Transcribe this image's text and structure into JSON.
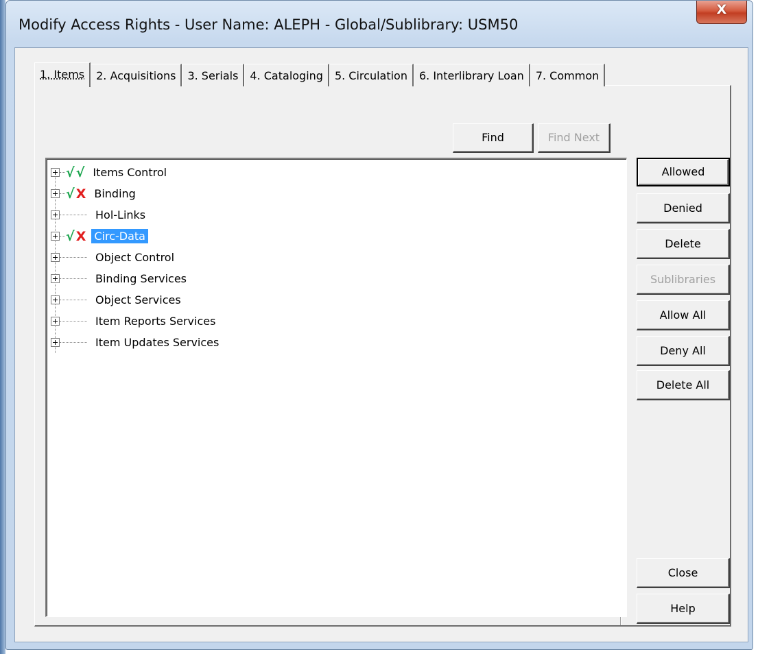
{
  "window": {
    "title": "Modify Access Rights - User Name: ALEPH - Global/Sublibrary: USM50",
    "close_glyph": "X"
  },
  "tabs": [
    {
      "label": "1. Items",
      "active": true
    },
    {
      "label": "2. Acquisitions",
      "active": false
    },
    {
      "label": "3. Serials",
      "active": false
    },
    {
      "label": "4. Cataloging",
      "active": false
    },
    {
      "label": "5. Circulation",
      "active": false
    },
    {
      "label": "6. Interlibrary Loan",
      "active": false
    },
    {
      "label": "7. Common",
      "active": false
    }
  ],
  "search": {
    "find_label": "Find",
    "find_next_label": "Find Next"
  },
  "tree": {
    "nodes": [
      {
        "label": "Items Control",
        "icons": [
          "check",
          "check"
        ],
        "selected": false
      },
      {
        "label": "Binding",
        "icons": [
          "check",
          "cross"
        ],
        "selected": false
      },
      {
        "label": "Hol-Links",
        "icons": [],
        "selected": false
      },
      {
        "label": "Circ-Data",
        "icons": [
          "check",
          "cross"
        ],
        "selected": true
      },
      {
        "label": "Object Control",
        "icons": [],
        "selected": false
      },
      {
        "label": "Binding Services",
        "icons": [],
        "selected": false
      },
      {
        "label": "Object Services",
        "icons": [],
        "selected": false
      },
      {
        "label": "Item Reports Services",
        "icons": [],
        "selected": false
      },
      {
        "label": "Item Updates Services",
        "icons": [],
        "selected": false
      }
    ],
    "glyphs": {
      "check": "√",
      "cross": "X"
    }
  },
  "actions": {
    "allowed": "Allowed",
    "denied": "Denied",
    "delete": "Delete",
    "sublibraries": "Sublibraries",
    "allow_all": "Allow All",
    "deny_all": "Deny All",
    "delete_all": "Delete All",
    "close": "Close",
    "help": "Help"
  },
  "colors": {
    "check": "#16a34a",
    "cross": "#e11d1d",
    "selection": "#3399ff",
    "close_button": "#c84a30"
  }
}
